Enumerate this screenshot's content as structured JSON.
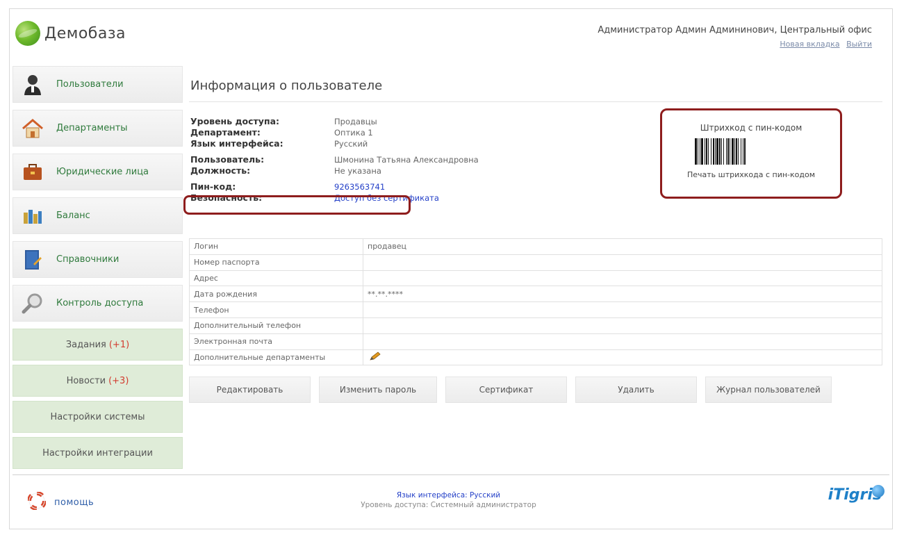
{
  "app": {
    "title": "Демобаза"
  },
  "header": {
    "user": "Администратор Админ Админинович, Центральный офис",
    "links": [
      "Новая вкладка",
      "Выйти"
    ]
  },
  "sidebar": {
    "items": [
      {
        "label": "Пользователи",
        "icon": "user-icon"
      },
      {
        "label": "Департаменты",
        "icon": "home-icon"
      },
      {
        "label": "Юридические лица",
        "icon": "briefcase-icon"
      },
      {
        "label": "Баланс",
        "icon": "chart-icon"
      },
      {
        "label": "Справочники",
        "icon": "book-icon"
      },
      {
        "label": "Контроль доступа",
        "icon": "magnifier-icon"
      }
    ],
    "extra": [
      {
        "label": "Задания",
        "badge": "(+1)"
      },
      {
        "label": "Новости",
        "badge": "(+3)"
      },
      {
        "label": "Настройки системы",
        "badge": ""
      },
      {
        "label": "Настройки интеграции",
        "badge": ""
      }
    ]
  },
  "main": {
    "title": "Информация о пользователе",
    "info": {
      "access_key": "Уровень доступа:",
      "access_val": "Продавцы",
      "dept_key": "Департамент:",
      "dept_val": "Оптика 1",
      "lang_key": "Язык интерфейса:",
      "lang_val": "Русский",
      "user_key": "Пользователь:",
      "user_val": "Шмонина Татьяна Александровна",
      "pos_key": "Должность:",
      "pos_val": "Не указана",
      "pin_key": "Пин-код:",
      "pin_val": "9263563741",
      "sec_key": "Безопасность:",
      "sec_val": "Доступ без сертификата"
    },
    "barcode": {
      "title": "Штрихкод с пин-кодом",
      "print": "Печать штрихкода с пин-кодом"
    },
    "details": [
      {
        "key": "Логин",
        "value": "продавец"
      },
      {
        "key": "Номер паспорта",
        "value": ""
      },
      {
        "key": "Адрес",
        "value": ""
      },
      {
        "key": "Дата рождения",
        "value": "**.**.****"
      },
      {
        "key": "Телефон",
        "value": ""
      },
      {
        "key": "Дополнительный телефон",
        "value": ""
      },
      {
        "key": "Электронная почта",
        "value": ""
      },
      {
        "key": "Дополнительные департаменты",
        "value": ""
      }
    ],
    "buttons": {
      "edit": "Редактировать",
      "change_password": "Изменить пароль",
      "certificate": "Сертификат",
      "delete": "Удалить",
      "journal": "Журнал пользователей"
    }
  },
  "footer": {
    "help": "помощь",
    "lang": "Язык интерфейса: Русский",
    "access": "Уровень доступа: Системный администратор",
    "brand": "iTigris"
  }
}
